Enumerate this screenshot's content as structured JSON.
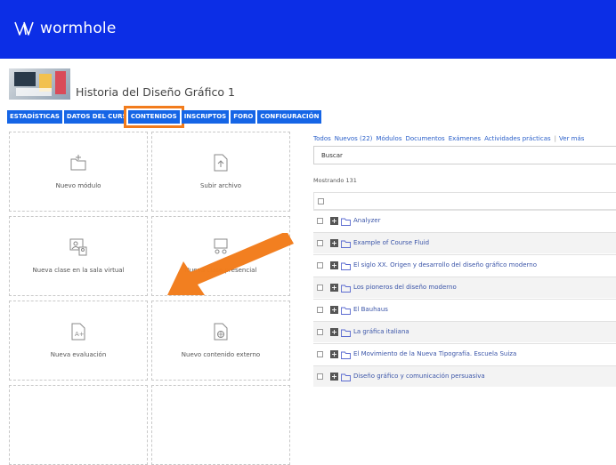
{
  "header": {
    "brand": "wormhole",
    "brand_color": "#0c2ee6"
  },
  "course": {
    "title": "Historia del Diseño Gráfico 1"
  },
  "tabs": [
    {
      "label": "ESTADÍSTICAS"
    },
    {
      "label": "DATOS DEL CURSO"
    },
    {
      "label": "CONTENIDOS",
      "active": true
    },
    {
      "label": "INSCRIPTOS"
    },
    {
      "label": "FORO"
    },
    {
      "label": "CONFIGURACIÓN"
    }
  ],
  "actions": [
    {
      "label": "Nuevo módulo",
      "icon": "folder-plus-icon"
    },
    {
      "label": "Subir archivo",
      "icon": "upload-file-icon"
    },
    {
      "label": "Nueva clase en la sala virtual",
      "icon": "virtual-class-icon"
    },
    {
      "label": "Nueva clase presencial",
      "icon": "classroom-icon"
    },
    {
      "label": "Nueva evaluación",
      "icon": "evaluation-icon"
    },
    {
      "label": "Nuevo contenido externo",
      "icon": "external-content-icon"
    }
  ],
  "filters": {
    "items": [
      "Todos",
      "Nuevos (22)",
      "Módulos",
      "Documentos",
      "Exámenes",
      "Actividades prácticas"
    ],
    "more": "Ver más"
  },
  "search": {
    "placeholder": "Buscar"
  },
  "listing": {
    "showing": "Mostrando 131"
  },
  "rows": [
    "Analyzer",
    "Example of Course Fluid",
    "El siglo XX. Origen y desarrollo del diseño gráfico moderno",
    "Los pioneros del diseño moderno",
    "El Bauhaus",
    "La gráfica italiana",
    "El Movimiento de la Nueva Tipografía. Escuela Suiza",
    "Diseño gráfico y comunicación persuasiva"
  ],
  "colors": {
    "tab": "#1565e6",
    "highlight": "#f27c1c",
    "link": "#3b55a8"
  }
}
